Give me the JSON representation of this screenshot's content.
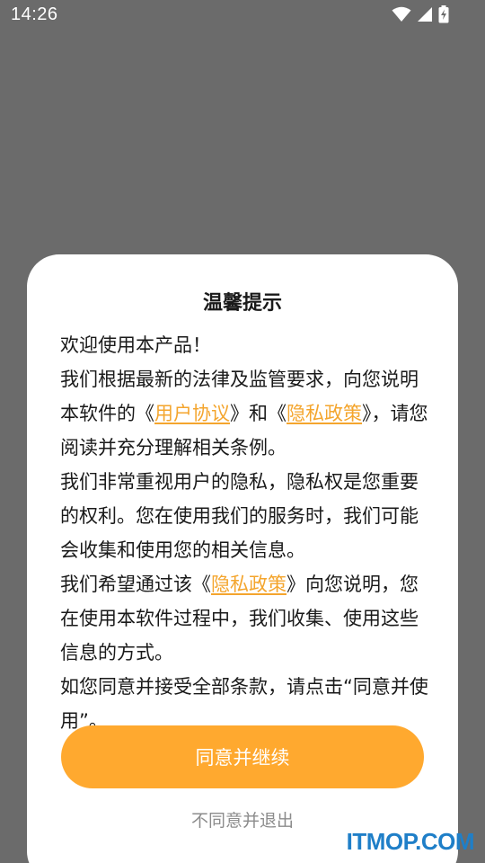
{
  "status_bar": {
    "time": "14:26",
    "icons": [
      "wifi-icon",
      "cell-signal-icon",
      "battery-charging-icon"
    ]
  },
  "dialog": {
    "title": "温馨提示",
    "body": {
      "intro": "欢迎使用本产品！",
      "p1_before": "我们根据最新的法律及监管要求，向您说明本软件的《",
      "link_user_agreement": "用户协议",
      "p1_mid": "》和《",
      "link_privacy_policy_1": "隐私政策",
      "p1_after": "》，请您阅读并充分理解相关条例。",
      "p2": "我们非常重视用户的隐私，隐私权是您重要的权利。您在使用我们的服务时，我们可能会收集和使用您的相关信息。",
      "p3_before": "我们希望通过该《",
      "link_privacy_policy_2": "隐私政策",
      "p3_after": "》向您说明，您在使用本软件过程中，我们收集、使用这些信息的方式。",
      "p4": "如您同意并接受全部条款，请点击“同意并使用”。"
    },
    "agree_label": "同意并继续",
    "disagree_label": "不同意并退出"
  },
  "colors": {
    "accent": "#ffa92f",
    "link": "#f4a52d",
    "backdrop": "#6b6b6b"
  },
  "watermark": "ITMOP.COM"
}
